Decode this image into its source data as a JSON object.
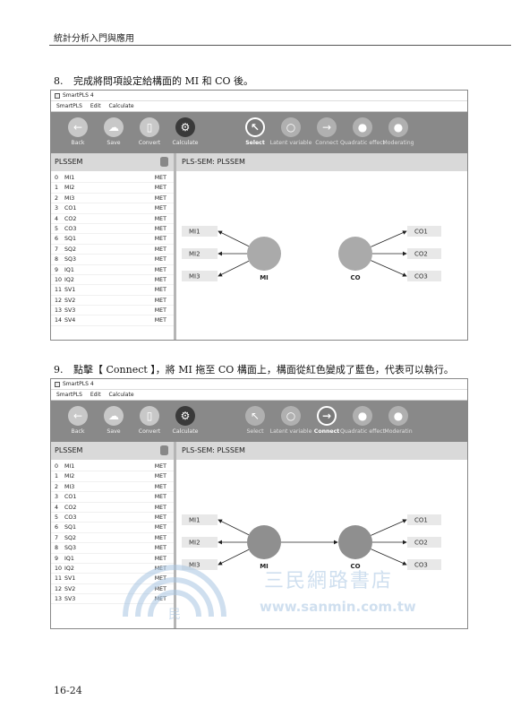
{
  "header": {
    "title": "統計分析入門與應用"
  },
  "step8": {
    "number": "8.",
    "text": "完成將問項設定給構面的 MI 和 CO 後。"
  },
  "step9": {
    "number": "9.",
    "text": "點擊【 Connect 】，將 MI 拖至 CO 構面上，構面從紅色變成了藍色，代表可以執行。"
  },
  "page_number": "16-24",
  "screens": [
    {
      "window_title": "SmartPLS 4",
      "menu": [
        "SmartPLS",
        "Edit",
        "Calculate"
      ],
      "toolbar": [
        {
          "label": "Back",
          "glyph": "←",
          "icon": "back-icon"
        },
        {
          "label": "Save",
          "glyph": "☁",
          "icon": "save-icon"
        },
        {
          "label": "Convert",
          "glyph": "▯",
          "icon": "convert-icon"
        },
        {
          "label": "Calculate",
          "glyph": "⚙",
          "icon": "calculate-icon"
        },
        {
          "label": "Select",
          "glyph": "↖",
          "icon": "select-icon"
        },
        {
          "label": "Latent variable",
          "glyph": "○",
          "icon": "latent-variable-icon"
        },
        {
          "label": "Connect",
          "glyph": "→",
          "icon": "connect-icon"
        },
        {
          "label": "Quadratic effect",
          "glyph": "●",
          "icon": "quadratic-effect-icon"
        },
        {
          "label": "Moderating",
          "glyph": "●",
          "icon": "moderating-icon"
        }
      ],
      "active_tool": "Select",
      "left_panel_title": "PLSSEM",
      "canvas_title": "PLS-SEM: PLSSEM",
      "indicators": [
        {
          "idx": "0",
          "name": "MI1",
          "type": "MET"
        },
        {
          "idx": "1",
          "name": "MI2",
          "type": "MET"
        },
        {
          "idx": "2",
          "name": "MI3",
          "type": "MET"
        },
        {
          "idx": "3",
          "name": "CO1",
          "type": "MET"
        },
        {
          "idx": "4",
          "name": "CO2",
          "type": "MET"
        },
        {
          "idx": "5",
          "name": "CO3",
          "type": "MET"
        },
        {
          "idx": "6",
          "name": "SQ1",
          "type": "MET"
        },
        {
          "idx": "7",
          "name": "SQ2",
          "type": "MET"
        },
        {
          "idx": "8",
          "name": "SQ3",
          "type": "MET"
        },
        {
          "idx": "9",
          "name": "IQ1",
          "type": "MET"
        },
        {
          "idx": "10",
          "name": "IQ2",
          "type": "MET"
        },
        {
          "idx": "11",
          "name": "SV1",
          "type": "MET"
        },
        {
          "idx": "12",
          "name": "SV2",
          "type": "MET"
        },
        {
          "idx": "13",
          "name": "SV3",
          "type": "MET"
        },
        {
          "idx": "14",
          "name": "SV4",
          "type": "MET"
        }
      ],
      "model": {
        "mi_indicators": [
          "MI1",
          "MI2",
          "MI3"
        ],
        "co_indicators": [
          "CO1",
          "CO2",
          "CO3"
        ],
        "construct_left": "MI",
        "construct_right": "CO",
        "connected": false
      }
    },
    {
      "window_title": "SmartPLS 4",
      "menu": [
        "SmartPLS",
        "Edit",
        "Calculate"
      ],
      "toolbar": [
        {
          "label": "Back",
          "glyph": "←",
          "icon": "back-icon"
        },
        {
          "label": "Save",
          "glyph": "☁",
          "icon": "save-icon"
        },
        {
          "label": "Convert",
          "glyph": "▯",
          "icon": "convert-icon"
        },
        {
          "label": "Calculate",
          "glyph": "⚙",
          "icon": "calculate-icon"
        },
        {
          "label": "Select",
          "glyph": "↖",
          "icon": "select-icon"
        },
        {
          "label": "Latent variable",
          "glyph": "○",
          "icon": "latent-variable-icon"
        },
        {
          "label": "Connect",
          "glyph": "→",
          "icon": "connect-icon"
        },
        {
          "label": "Quadratic effect",
          "glyph": "●",
          "icon": "quadratic-effect-icon"
        },
        {
          "label": "Moderatin",
          "glyph": "●",
          "icon": "moderating-icon"
        }
      ],
      "active_tool": "Connect",
      "left_panel_title": "PLSSEM",
      "canvas_title": "PLS-SEM: PLSSEM",
      "indicators": [
        {
          "idx": "0",
          "name": "MI1",
          "type": "MET"
        },
        {
          "idx": "1",
          "name": "MI2",
          "type": "MET"
        },
        {
          "idx": "2",
          "name": "MI3",
          "type": "MET"
        },
        {
          "idx": "3",
          "name": "CO1",
          "type": "MET"
        },
        {
          "idx": "4",
          "name": "CO2",
          "type": "MET"
        },
        {
          "idx": "5",
          "name": "CO3",
          "type": "MET"
        },
        {
          "idx": "6",
          "name": "SQ1",
          "type": "MET"
        },
        {
          "idx": "7",
          "name": "SQ2",
          "type": "MET"
        },
        {
          "idx": "8",
          "name": "SQ3",
          "type": "MET"
        },
        {
          "idx": "9",
          "name": "IQ1",
          "type": "MET"
        },
        {
          "idx": "10",
          "name": "IQ2",
          "type": "MET"
        },
        {
          "idx": "11",
          "name": "SV1",
          "type": "MET"
        },
        {
          "idx": "12",
          "name": "SV2",
          "type": "MET"
        },
        {
          "idx": "13",
          "name": "SV3",
          "type": "MET"
        }
      ],
      "model": {
        "mi_indicators": [
          "MI1",
          "MI2",
          "MI3"
        ],
        "co_indicators": [
          "CO1",
          "CO2",
          "CO3"
        ],
        "construct_left": "MI",
        "construct_right": "CO",
        "connected": true
      }
    }
  ],
  "watermark": {
    "text": "三民網路書店",
    "url": "www.sanmin.com.tw",
    "logo_letter": "民"
  },
  "colors": {
    "toolbar_bg": "#898989",
    "panel_head": "#d9d9d9",
    "construct": "#aaaaaa",
    "construct_connected": "#8f8f8f",
    "indicator_box": "#e8e8e8",
    "watermark": "#a9c6e2"
  }
}
